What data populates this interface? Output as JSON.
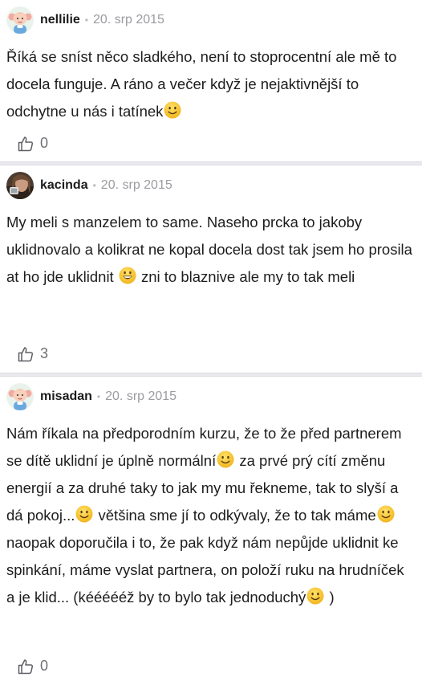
{
  "comments": [
    {
      "author": "nellilie",
      "separator": "•",
      "date": "20. srp 2015",
      "avatar_icon": "cartoon-baby-avatar",
      "text_parts": [
        "Říká se sníst něco sladkého, není to stoprocentní ale mě to docela funguje. A ráno a večer když je nejaktivnější to odchytne u nás i tatínek"
      ],
      "likes": "0"
    },
    {
      "author": "kacinda",
      "separator": "•",
      "date": "20. srp 2015",
      "avatar_icon": "photo-avatar",
      "text_parts": [
        "My meli s manzelem to same. Naseho prcka to jakoby uklidnovalo a kolikrat ne kopal docela dost tak jsem ho prosila at ho jde uklidnit ",
        " zni to blaznive ale my to tak meli"
      ],
      "likes": "3"
    },
    {
      "author": "misadan",
      "separator": "•",
      "date": "20. srp 2015",
      "avatar_icon": "cartoon-baby-avatar",
      "text_parts": [
        "Nám říkala na předporodním kurzu, že to že před partnerem se dítě uklidní je úplně normální",
        " za prvé prý cítí změnu energií a za druhé taky to jak my mu řekneme, tak to slyší a dá pokoj...",
        " většina sme jí to odkývaly, že to tak máme",
        " naopak doporučila i to, že pak když nám nepůjde uklidnit ke spinkání, máme vyslat partnera, on položí ruku na hrudníček a je klid... (kéééééž by to bylo tak jednoduchý",
        " )"
      ],
      "likes": "0"
    }
  ],
  "icons": {
    "like": "thumbs-up-icon",
    "smile": "smiling-emoji",
    "grin": "grinning-emoji"
  },
  "colors": {
    "divider": "#e9e9ee",
    "emoji": "#f6c12a",
    "meta_gray": "#9b9ba1"
  }
}
